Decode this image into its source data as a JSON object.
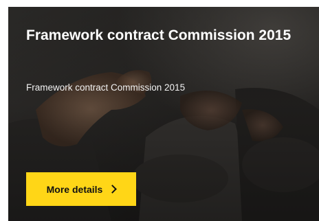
{
  "card": {
    "title": "Framework contract Commission 2015",
    "description": "Framework contract Commission 2015",
    "button_label": "More details",
    "button_icon": "chevron-right-icon",
    "background_image": "people-gesturing-in-meeting-photo",
    "colors": {
      "button_background": "#ffd617",
      "button_text": "#111111",
      "title_text": "#ffffff"
    }
  }
}
